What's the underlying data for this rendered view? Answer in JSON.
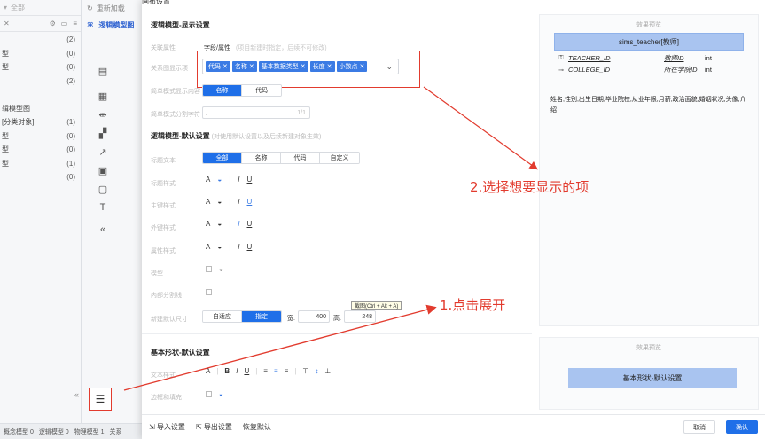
{
  "left_panel": {
    "top_label": "全部",
    "tree": [
      {
        "label": "",
        "count": "(2)"
      },
      {
        "label": "型",
        "count": "(0)"
      },
      {
        "label": "型",
        "count": "(0)"
      },
      {
        "label": "",
        "count": "(2)"
      },
      {
        "label": "",
        "count": ""
      },
      {
        "label": "辑模型图",
        "count": ""
      },
      {
        "label": "[分类对象]",
        "count": "(1)"
      },
      {
        "label": "型",
        "count": "(0)"
      },
      {
        "label": "型",
        "count": "(0)"
      },
      {
        "label": "型",
        "count": "(1)"
      },
      {
        "label": "",
        "count": "(0)"
      }
    ],
    "status": [
      "概念模型 0",
      "逻辑模型 0",
      "物理模型 1",
      "关系"
    ]
  },
  "mid_panel": {
    "reload": "重新加载",
    "title": "逻辑模型图"
  },
  "modal": {
    "title": "画布设置",
    "display_section": {
      "title": "逻辑模型-显示设置",
      "link_object_label": "关联属性",
      "link_object_value": "字段/属性",
      "link_object_hint": "(项目新建时指定，后续不可修改)",
      "show_items_label": "关系图显示项",
      "tags": [
        "代码",
        "名称",
        "基本数据类型",
        "长度",
        "小数点"
      ],
      "simple_mode_label": "简单模式显示内容",
      "simple_mode_options": [
        "名称",
        "代码"
      ],
      "simple_sep_label": "简单模式分割字符",
      "simple_sep_value": ",",
      "simple_sep_count": "1/1"
    },
    "default_section": {
      "title": "逻辑模型-默认设置",
      "subtitle": "(对使用默认设置以及后续新建对象生效)",
      "title_text_label": "标题文本",
      "title_text_options": [
        "全部",
        "名称",
        "代码",
        "自定义"
      ],
      "rows": [
        "标题样式",
        "主键样式",
        "外键样式",
        "属性样式",
        "模型",
        "内部分割线"
      ],
      "size_label": "新建默认尺寸",
      "size_options": [
        "自适应",
        "指定"
      ],
      "width_label": "宽:",
      "width_value": "400",
      "height_label": "高:",
      "height_value": "248"
    },
    "basic_section": {
      "title": "基本形状-默认设置",
      "text_style_label": "文本样式",
      "border_label": "边框和填充"
    },
    "preview": {
      "title": "效果预览",
      "entity_name": "sims_teacher[教师]",
      "rows": [
        {
          "icon": "key-icon",
          "code": "TEACHER_ID",
          "name": "教师ID",
          "type": "int"
        },
        {
          "icon": "link-icon",
          "code": "COLLEGE_ID",
          "name": "所在学院ID",
          "type": "int"
        }
      ],
      "attrs": "姓名,性别,出生日期,毕业院校,从业年限,月薪,政治面貌,婚姻状况,头像,介绍"
    },
    "preview2": {
      "title": "效果预览",
      "shape_label": "基本形状-默认设置"
    },
    "footer": {
      "import": "导入设置",
      "export": "导出设置",
      "reset": "恢复默认",
      "cancel": "取消",
      "confirm": "确认"
    },
    "tooltip": "截图(Ctrl + Alt + A)"
  },
  "annotations": {
    "step1": "1.点击展开",
    "step2": "2.选择想要显示的项"
  },
  "colors": {
    "primary": "#1f6fe8",
    "annotation": "#e23b2e",
    "tag": "#3b7be4",
    "entity_header": "#a9c4f0"
  }
}
